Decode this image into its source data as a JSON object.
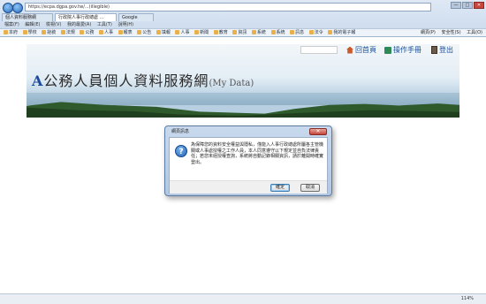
{
  "browser": {
    "address": "https://ecpa.dgpa.gov.tw/...(illegible)",
    "tabs": [
      {
        "label": "個人資料服務網",
        "active": false
      },
      {
        "label": "行政院人事行政總處 ...",
        "active": true
      },
      {
        "label": "Google",
        "active": false
      }
    ],
    "menu": [
      "檔案(F)",
      "編輯(E)",
      "檢視(V)",
      "我的最愛(A)",
      "工具(T)",
      "說明(H)"
    ],
    "favorites": [
      "本府",
      "學校",
      "銓敘",
      "法規",
      "公務",
      "人事",
      "報表",
      "公告",
      "填報",
      "人事",
      "新聞",
      "教育",
      "資訊",
      "系統",
      "系統",
      "訊息",
      "法令",
      "我的電子報"
    ],
    "commands": [
      "網頁(P)",
      "安全性(S)",
      "工具(O)"
    ],
    "window_controls": [
      "—",
      "□",
      "✕"
    ]
  },
  "site": {
    "logo_letter": "A",
    "title": "公務人員個人資料服務網",
    "subtitle": "(My Data)",
    "links": {
      "home": "回首頁",
      "manual": "操作手冊",
      "logout": "登出"
    }
  },
  "dialog": {
    "title": "網頁訊息",
    "message": "為保障您的資料安全權益與隱私，僅能入人事行政總處所屬各主管機關或人事處授權之工作人員，本人同意遵守以下規定並自負法律責任；若您未經授權查詢，系統將自動記錄相關資訊，請於離開時確實登出。",
    "ok_label": "確定",
    "cancel_label": "取消"
  },
  "status": {
    "zoom": "114%"
  }
}
